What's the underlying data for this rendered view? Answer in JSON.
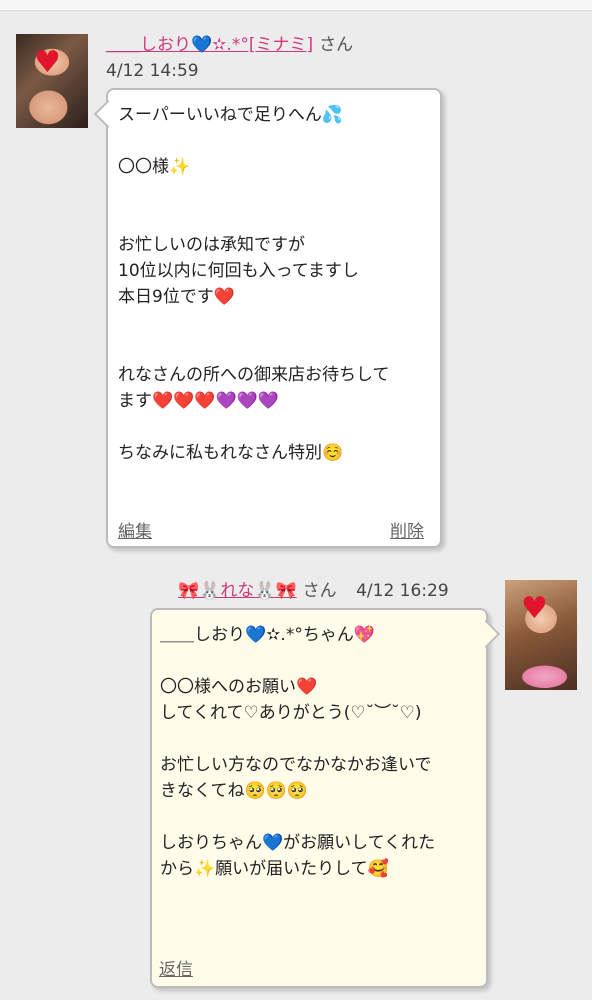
{
  "message1": {
    "username": "＿＿しおり💙✫.*°[ミナミ]",
    "honorific": "さん",
    "timestamp": "4/12 14:59",
    "body": "スーパーいいねで足りへん💦\n\n〇〇様✨\n\n\nお忙しいのは承知ですが\n10位以内に何回も入ってますし\n本日9位です❤️\n\n\nれなさんの所への御来店お待ちして\nます❤️❤️❤️💜💜💜\n\nちなみに私もれなさん特別☺️",
    "edit_label": "編集",
    "delete_label": "削除"
  },
  "message2": {
    "username": "🎀🐰れな🐰🎀",
    "honorific": "さん",
    "timestamp": "4/12 16:29",
    "body": "＿＿しおり💙✫.*°ちゃん💖\n\n〇〇様へのお願い❤️\nしてくれて♡ありがとう(♡˘︶˘♡)\n\nお忙しい方なのでなかなかお逢いで\nきなくてね🥺🥺🥺\n\nしおりちゃん💙がお願いしてくれた\nから✨願いが届いたりして🥰",
    "reply_label": "返信"
  },
  "colors": {
    "username": "#d2377a",
    "bubble_own": "#fffdea",
    "bubble_other": "#ffffff",
    "background": "#ececec"
  },
  "icons": [
    "heart-icon"
  ]
}
